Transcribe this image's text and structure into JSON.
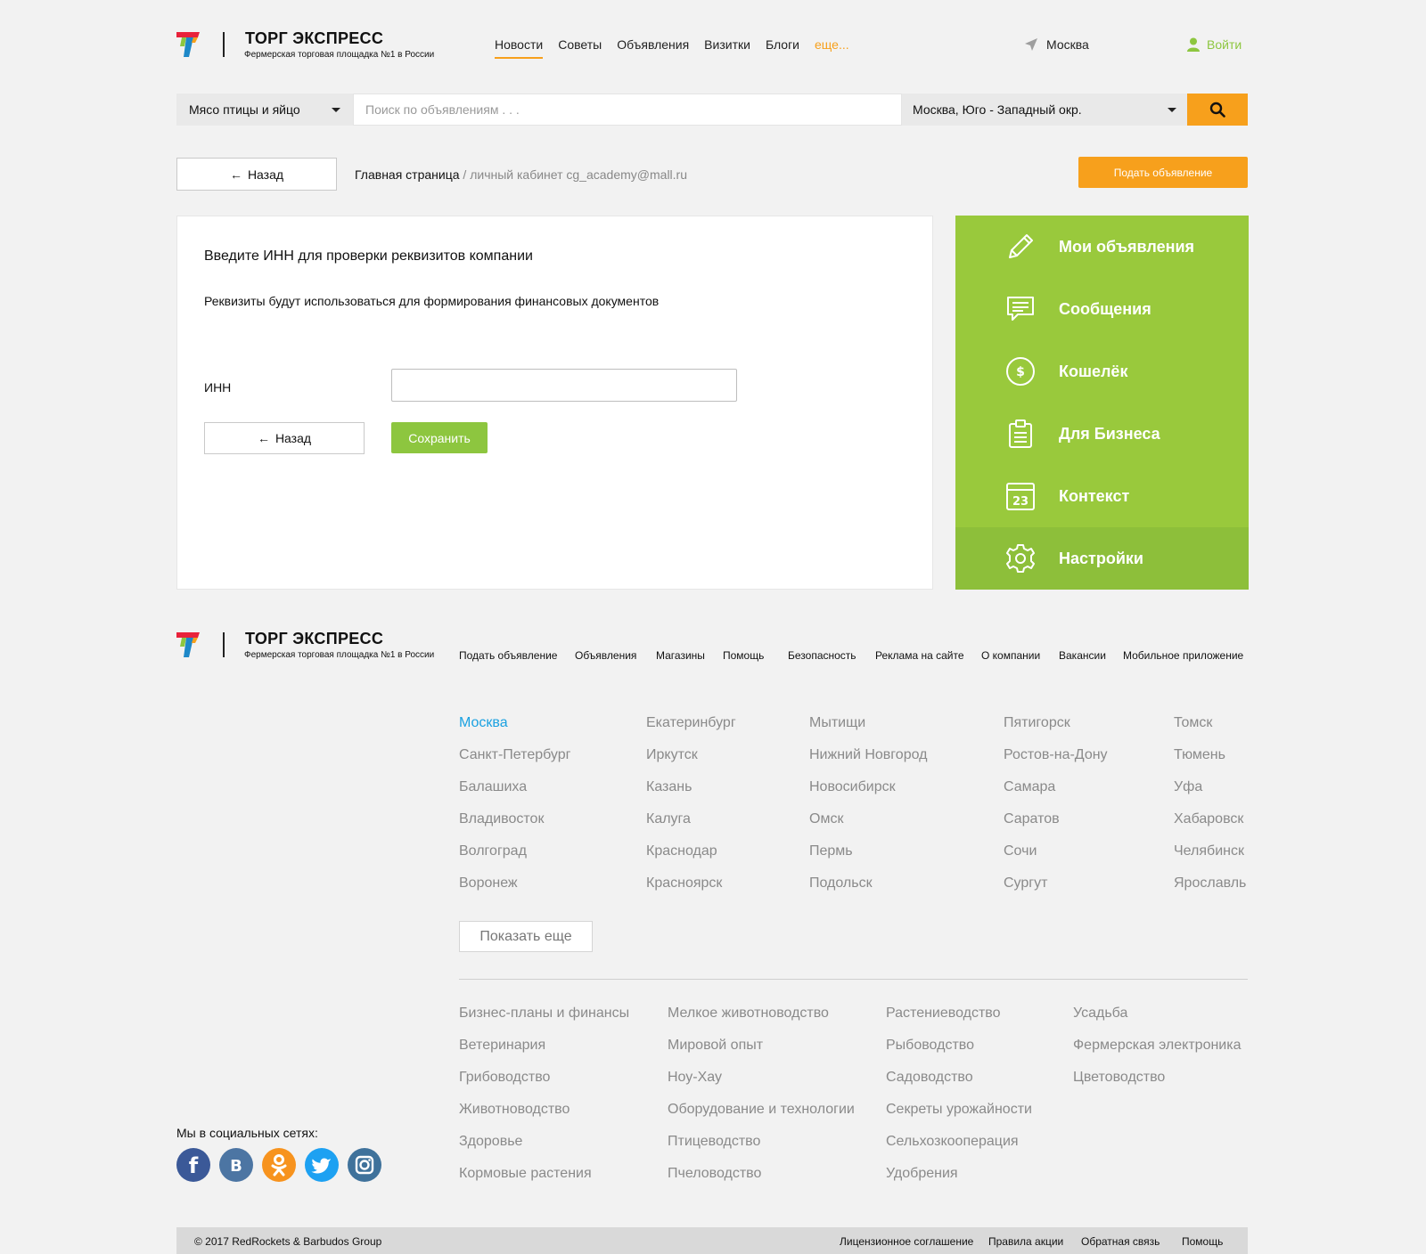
{
  "brand": {
    "title": "ТОРГ ЭКСПРЕСС",
    "subtitle": "Фермерская торговая площадка №1 в России"
  },
  "header": {
    "nav": [
      "Новости",
      "Советы",
      "Объявления",
      "Визитки",
      "Блоги"
    ],
    "nav_more": "еще...",
    "city": "Москва",
    "login": "Войти"
  },
  "search": {
    "category": "Мясо птицы и яйцо",
    "placeholder": "Поиск по объявлениям . . .",
    "location": "Москва, Юго - Западный окр."
  },
  "breadcrumb": {
    "back": "Назад",
    "home": "Главная страница",
    "rest": "/ личный кабинет cg_academy@mall.ru"
  },
  "post_ad": "Подать объявление",
  "form": {
    "title": "Введите ИНН для проверки реквизитов компании",
    "subtitle": "Реквизиты будут использоваться для формирования финансовых документов",
    "inn_label": "ИНН",
    "inn_value": "",
    "back": "Назад",
    "save": "Сохранить"
  },
  "sidemenu": {
    "items": [
      {
        "label": "Мои объявления",
        "icon": "pencil-icon"
      },
      {
        "label": "Сообщения",
        "icon": "chat-icon"
      },
      {
        "label": "Кошелёк",
        "icon": "dollar-coin-icon"
      },
      {
        "label": "Для Бизнеса",
        "icon": "clipboard-icon"
      },
      {
        "label": "Контекст",
        "icon": "calendar-icon",
        "calendar_day": "23"
      },
      {
        "label": "Настройки",
        "icon": "gear-icon",
        "active": true
      }
    ]
  },
  "footer": {
    "nav": [
      "Подать объявление",
      "Объявления",
      "Магазины",
      "Помощь",
      "Безопасность",
      "Реклама на сайте",
      "О компании",
      "Вакансии",
      "Мобильное приложение"
    ],
    "cities": [
      [
        "Москва",
        "Санкт-Петербург",
        "Балашиха",
        "Владивосток",
        "Волгоград",
        "Воронеж"
      ],
      [
        "Екатеринбург",
        "Иркутск",
        "Казань",
        "Калуга",
        "Краснодар",
        "Красноярск"
      ],
      [
        "Мытищи",
        "Нижний Новгород",
        "Новосибирск",
        "Омск",
        "Пермь",
        "Подольск"
      ],
      [
        "Пятигорск",
        "Ростов-на-Дону",
        "Самара",
        "Саратов",
        "Сочи",
        "Сургут"
      ],
      [
        "Томск",
        "Тюмень",
        "Уфа",
        "Хабаровск",
        "Челябинск",
        "Ярославль"
      ]
    ],
    "show_more": "Показать еще",
    "categories": [
      [
        "Бизнес-планы и финансы",
        "Ветеринария",
        "Грибоводство",
        "Животноводство",
        "Здоровье",
        "Кормовые растения"
      ],
      [
        "Мелкое животноводство",
        "Мировой опыт",
        "Ноу-Хау",
        "Оборудование и технологии",
        "Птицеводство",
        "Пчеловодство"
      ],
      [
        "Растениеводство",
        "Рыбоводство",
        "Садоводство",
        "Секреты урожайности",
        "Сельхозкооперация",
        "Удобрения"
      ],
      [
        "Усадьба",
        "Фермерская электроника",
        "Цветоводство"
      ]
    ],
    "social_title": "Мы в социальных сетях:",
    "social": [
      {
        "name": "facebook-icon",
        "letter": "f",
        "color": "#3b5998"
      },
      {
        "name": "vk-icon",
        "letter": "В",
        "color": "#4c75a3"
      },
      {
        "name": "odnoklassniki-icon",
        "letter": "",
        "color": "#f7931e"
      },
      {
        "name": "twitter-icon",
        "letter": "",
        "color": "#1da1f2"
      },
      {
        "name": "instagram-icon",
        "letter": "",
        "color": "#3f729b"
      }
    ],
    "copyright": "© 2017 RedRockets & Barbudos Group",
    "bottom_links": [
      "Лицензионное соглашение",
      "Правила акции",
      "Обратная связь",
      "Помощь"
    ]
  },
  "colors": {
    "accent_orange": "#f7a01c",
    "accent_green": "#8dc63f",
    "sidemenu_bg": "#99c93c",
    "selected_city": "#1aa1e1"
  }
}
